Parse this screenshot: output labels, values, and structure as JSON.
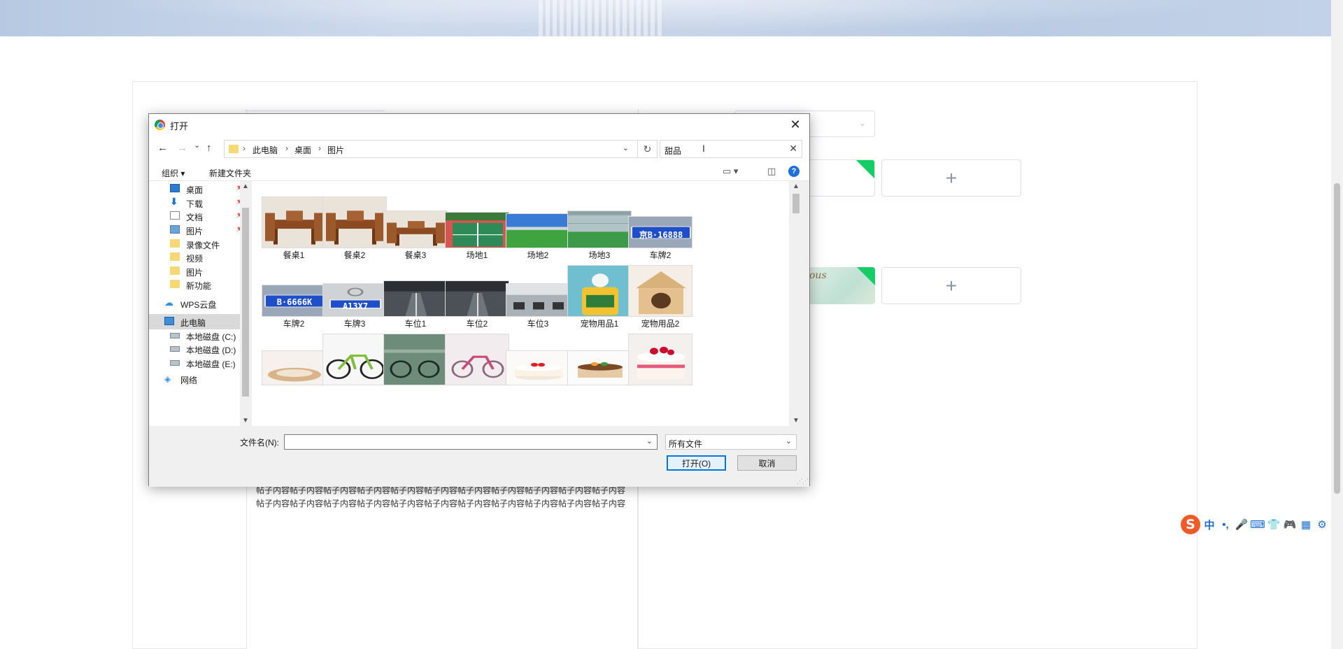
{
  "background_page": {
    "post_text": "帖子内容帖子内容帖子内容帖子内容帖子内容帖子内容帖子内容帖子内容帖子内容帖子内容帖子内容帖子内容帖子内容帖子内容帖子内容帖子内容帖子内容帖子内容帖子内容帖子内容帖子内容帖子内容",
    "image_card_text": "ous",
    "upload_plus": "+"
  },
  "dialog": {
    "title": "打开",
    "nav": {
      "back": "←",
      "forward": "→",
      "recent": "⌄",
      "up": "↑"
    },
    "address": {
      "segments": [
        "此电脑",
        "桌面",
        "图片"
      ],
      "separator": "›"
    },
    "search": {
      "value": "甜品"
    },
    "commands": {
      "organize": "组织 ▾",
      "new_folder": "新建文件夹"
    },
    "nav_pane": [
      {
        "label": "桌面",
        "icon": "desktop-icon",
        "pinned": true
      },
      {
        "label": "下载",
        "icon": "download-icon",
        "pinned": true
      },
      {
        "label": "文档",
        "icon": "document-icon",
        "pinned": true
      },
      {
        "label": "图片",
        "icon": "pictures-icon",
        "pinned": true
      },
      {
        "label": "录像文件",
        "icon": "folder-icon",
        "pinned": false
      },
      {
        "label": "视频",
        "icon": "folder-icon",
        "pinned": false
      },
      {
        "label": "图片",
        "icon": "folder-icon",
        "pinned": false
      },
      {
        "label": "新功能",
        "icon": "folder-icon",
        "pinned": false
      },
      {
        "label": "WPS云盘",
        "icon": "cloud-icon",
        "pinned": false
      },
      {
        "label": "此电脑",
        "icon": "pc-icon",
        "pinned": false,
        "selected": true
      },
      {
        "label": "本地磁盘 (C:)",
        "icon": "drive-icon",
        "pinned": false
      },
      {
        "label": "本地磁盘 (D:)",
        "icon": "drive-icon",
        "pinned": false
      },
      {
        "label": "本地磁盘 (E:)",
        "icon": "drive-icon",
        "pinned": false
      },
      {
        "label": "网络",
        "icon": "network-icon",
        "pinned": false
      }
    ],
    "files": [
      {
        "name": "餐桌1",
        "kind": "table"
      },
      {
        "name": "餐桌2",
        "kind": "table"
      },
      {
        "name": "餐桌3",
        "kind": "table"
      },
      {
        "name": "场地1",
        "kind": "court"
      },
      {
        "name": "场地2",
        "kind": "field"
      },
      {
        "name": "场地3",
        "kind": "indoor"
      },
      {
        "name": "车牌2",
        "kind": "plate",
        "plate_text": "京B·16888"
      },
      {
        "name": "车牌2",
        "kind": "plate",
        "plate_text": "B·6666K"
      },
      {
        "name": "车牌3",
        "kind": "plate-car",
        "plate_text": "A13X7"
      },
      {
        "name": "车位1",
        "kind": "parking"
      },
      {
        "name": "车位2",
        "kind": "parking"
      },
      {
        "name": "车位3",
        "kind": "parking-light"
      },
      {
        "name": "宠物用品1",
        "kind": "pet"
      },
      {
        "name": "宠物用品2",
        "kind": "pethouse"
      },
      {
        "name": "",
        "kind": "petbed"
      },
      {
        "name": "",
        "kind": "bike"
      },
      {
        "name": "",
        "kind": "bikes"
      },
      {
        "name": "",
        "kind": "bike-pink"
      },
      {
        "name": "",
        "kind": "cake"
      },
      {
        "name": "",
        "kind": "cake-choc"
      },
      {
        "name": "",
        "kind": "cake-berry"
      }
    ],
    "footer": {
      "filename_label": "文件名(N):",
      "filename_value": "",
      "filetype": "所有文件",
      "open_button": "打开(O)",
      "cancel_button": "取消"
    }
  },
  "ime_toolbar": {
    "logo": "S",
    "items": [
      "中",
      "•,",
      "🎤",
      "⌨",
      "👕",
      "🎮",
      "▦",
      "⚙"
    ]
  }
}
